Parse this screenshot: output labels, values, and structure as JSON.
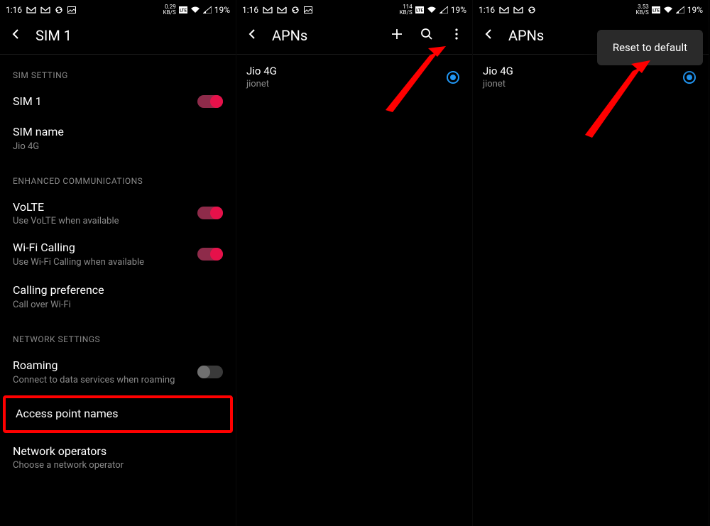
{
  "status": {
    "time": "1:16",
    "battery": "19%",
    "speed1": "0.29",
    "speed2": "114",
    "speed3": "3.53",
    "unit": "KB/S"
  },
  "panel1": {
    "title": "SIM 1",
    "section_sim": "SIM SETTING",
    "sim1_label": "SIM 1",
    "sim_name_label": "SIM name",
    "sim_name_value": "Jio 4G",
    "section_enhanced": "ENHANCED COMMUNICATIONS",
    "volte_label": "VoLTE",
    "volte_sub": "Use VoLTE when available",
    "wifi_calling_label": "Wi-Fi Calling",
    "wifi_calling_sub": "Use Wi-Fi Calling when available",
    "calling_pref_label": "Calling preference",
    "calling_pref_sub": "Call over Wi-Fi",
    "section_network": "NETWORK SETTINGS",
    "roaming_label": "Roaming",
    "roaming_sub": "Connect to data services when roaming",
    "apn_label": "Access point names",
    "operators_label": "Network operators",
    "operators_sub": "Choose a network operator"
  },
  "panel2": {
    "title": "APNs",
    "apn_name": "Jio 4G",
    "apn_value": "jionet"
  },
  "panel3": {
    "title": "APNs",
    "apn_name": "Jio 4G",
    "apn_value": "jionet",
    "menu_reset": "Reset to default"
  }
}
